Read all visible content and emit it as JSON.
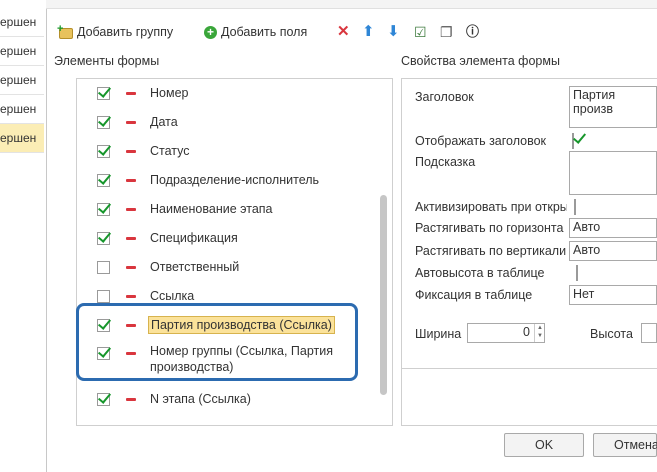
{
  "background_list": {
    "rows": [
      "ершен",
      "ершен",
      "ершен",
      "ершен",
      "ершен"
    ]
  },
  "toolbar": {
    "add_group": "Добавить группу",
    "add_fields": "Добавить поля"
  },
  "left_panel": {
    "title": "Элементы формы",
    "items": [
      {
        "label": "Номер",
        "checked": true
      },
      {
        "label": "Дата",
        "checked": true
      },
      {
        "label": "Статус",
        "checked": true
      },
      {
        "label": "Подразделение-исполнитель",
        "checked": true
      },
      {
        "label": "Наименование этапа",
        "checked": true
      },
      {
        "label": "Спецификация",
        "checked": true
      },
      {
        "label": "Ответственный",
        "checked": false
      },
      {
        "label": "Ссылка",
        "checked": false
      },
      {
        "label": "Партия производства (Ссылка)",
        "checked": true,
        "selected": true
      },
      {
        "label": "Номер группы (Ссылка, Партия",
        "label2": "производства)",
        "checked": true
      },
      {
        "label": "N этапа (Ссылка)",
        "checked": true
      }
    ]
  },
  "right_panel": {
    "title": "Свойства элемента формы",
    "props": {
      "header_label": "Заголовок",
      "header_value": "Партия произв",
      "show_header_label": "Отображать заголовок",
      "show_header_checked": true,
      "hint_label": "Подсказка",
      "hint_value": "",
      "activate_label": "Активизировать при откры",
      "stretch_h_label": "Растягивать по горизонта",
      "stretch_h_value": "Авто",
      "stretch_v_label": "Растягивать по вертикали",
      "stretch_v_value": "Авто",
      "autoheight_label": "Автовысота в таблице",
      "fix_label": "Фиксация в таблице",
      "fix_value": "Нет",
      "width_label": "Ширина",
      "width_value": "0",
      "height_label": "Высота"
    }
  },
  "buttons": {
    "ok": "OK",
    "cancel": "Отмена"
  }
}
